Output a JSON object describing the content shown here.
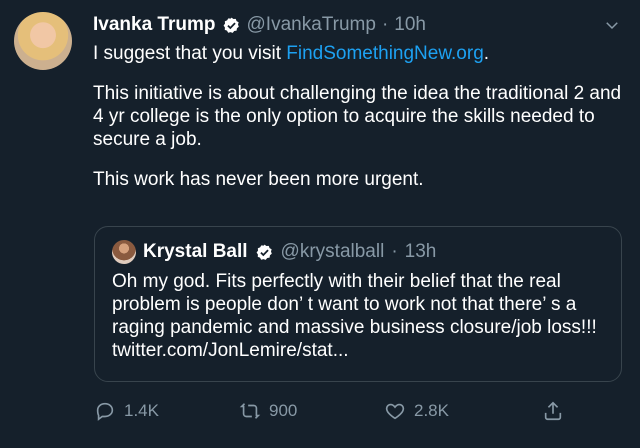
{
  "tweet": {
    "author_name": "Ivanka Trump",
    "author_handle": "@IvankaTrump",
    "separator": "·",
    "time": "10h",
    "para1_text": "I suggest that you visit ",
    "para1_link": "FindSomethingNew.org",
    "para1_end": ".",
    "para2": "This initiative is about challenging the idea the traditional 2 and 4 yr college is the only option to acquire the skills needed to secure a job.",
    "para3": "This work has never been more urgent."
  },
  "quoted": {
    "author_name": "Krystal Ball",
    "author_handle": "@krystalball",
    "separator": "·",
    "time": "13h",
    "text": "Oh my god. Fits perfectly with their belief that the real problem is people don’ t want to work not that there’ s a raging pandemic and massive business closure/job loss!!! twitter.com/JonLemire/stat..."
  },
  "actions": {
    "replies": "1.4K",
    "retweets": "900",
    "likes": "2.8K"
  },
  "icons": {
    "verified": "verified-badge-icon",
    "menu": "chevron-down-icon",
    "reply": "reply-icon",
    "retweet": "retweet-icon",
    "like": "heart-icon",
    "share": "share-icon"
  }
}
